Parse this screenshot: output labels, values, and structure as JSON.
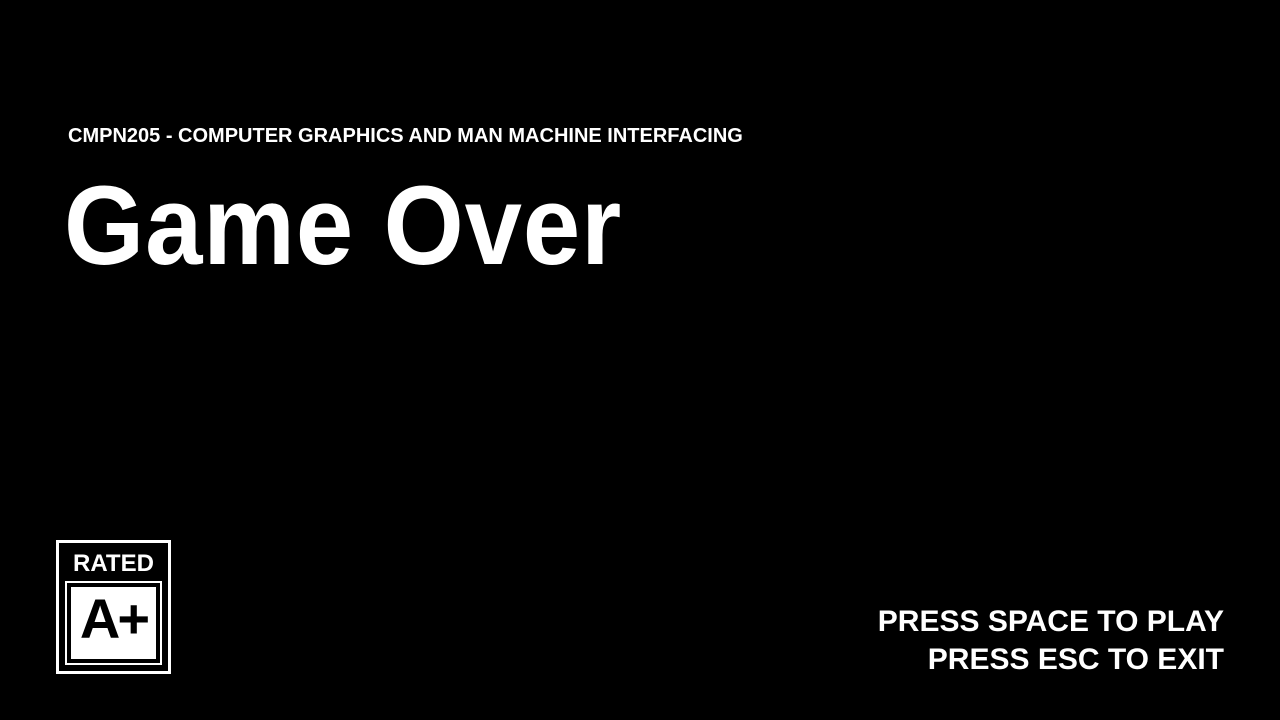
{
  "header": {
    "course_title": "CMPN205 - COMPUTER GRAPHICS AND MAN MACHINE INTERFACING",
    "screen_title": "Game Over"
  },
  "rating": {
    "label": "RATED",
    "value": "A+"
  },
  "instructions": {
    "play": "PRESS SPACE TO PLAY",
    "exit": "PRESS ESC TO EXIT"
  },
  "colors": {
    "background": "#000000",
    "text": "#ffffff"
  }
}
